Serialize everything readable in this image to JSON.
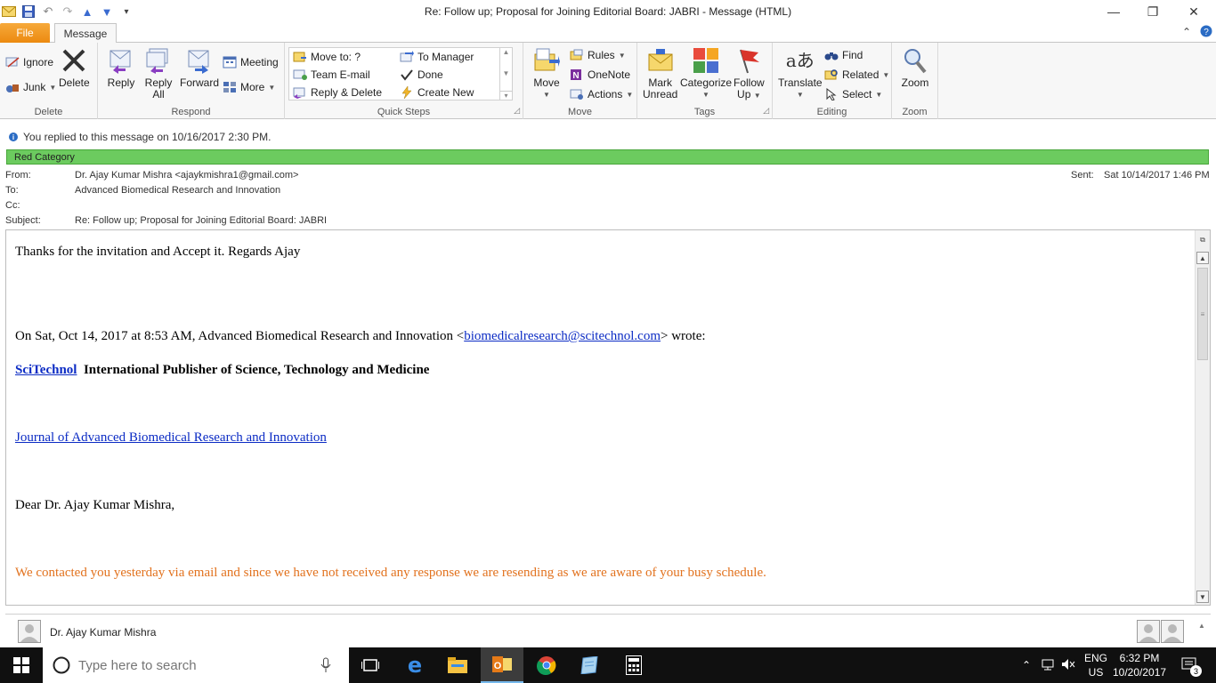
{
  "window": {
    "title": "Re: Follow up; Proposal for Joining Editorial Board: JABRI  -  Message (HTML)"
  },
  "tabs": {
    "file": "File",
    "message": "Message"
  },
  "ribbon": {
    "delete_group": {
      "label": "Delete",
      "ignore": "Ignore",
      "junk": "Junk",
      "delete": "Delete"
    },
    "respond_group": {
      "label": "Respond",
      "reply": "Reply",
      "reply_all_1": "Reply",
      "reply_all_2": "All",
      "forward": "Forward",
      "meeting": "Meeting",
      "more": "More"
    },
    "quicksteps_group": {
      "label": "Quick Steps",
      "move_to": "Move to: ?",
      "team_email": "Team E-mail",
      "reply_delete": "Reply & Delete",
      "to_manager": "To Manager",
      "done": "Done",
      "create_new": "Create New"
    },
    "move_group": {
      "label": "Move",
      "move": "Move",
      "rules": "Rules",
      "onenote": "OneNote",
      "actions": "Actions"
    },
    "tags_group": {
      "label": "Tags",
      "mark_unread_1": "Mark",
      "mark_unread_2": "Unread",
      "categorize": "Categorize",
      "follow_up_1": "Follow",
      "follow_up_2": "Up"
    },
    "editing_group": {
      "label": "Editing",
      "translate": "Translate",
      "find": "Find",
      "related": "Related",
      "select": "Select"
    },
    "zoom_group": {
      "label": "Zoom",
      "zoom": "Zoom"
    }
  },
  "info_bar": "You replied to this message on 10/16/2017 2:30 PM.",
  "category": "Red Category",
  "header": {
    "from_label": "From:",
    "from_value": "Dr. Ajay Kumar Mishra <ajaykmishra1@gmail.com>",
    "to_label": "To:",
    "to_value": "Advanced Biomedical Research and Innovation",
    "cc_label": "Cc:",
    "subject_label": "Subject:",
    "subject_value": "Re: Follow up; Proposal for Joining Editorial Board: JABRI",
    "sent_label": "Sent:",
    "sent_value": "Sat 10/14/2017 1:46 PM"
  },
  "body": {
    "line1": "Thanks for the invitation and Accept it. Regards Ajay",
    "quote_prefix": "On Sat, Oct 14, 2017 at 8:53 AM, Advanced Biomedical Research and Innovation <",
    "quote_email": "biomedicalresearch@scitechnol.com",
    "quote_suffix": "> wrote:",
    "brand_link": "SciTechnol",
    "brand_tagline": "International Publisher of Science, Technology and Medicine",
    "journal_link": "Journal of Advanced Biomedical Research and Innovation",
    "greeting": "Dear Dr. Ajay Kumar Mishra,",
    "orange_line": "We contacted you yesterday via email and since we have not received any response we are resending as we are aware of your busy schedule."
  },
  "people_pane": {
    "name": "Dr. Ajay Kumar Mishra"
  },
  "taskbar": {
    "search_placeholder": "Type here to search",
    "lang_1": "ENG",
    "lang_2": "US",
    "time": "6:32 PM",
    "date": "10/20/2017",
    "notifications": "3"
  },
  "colors": {
    "file_tab": "#ec8a10",
    "category_green": "#6ccb5f",
    "link_blue": "#0b2bc4",
    "orange_text": "#e2721e"
  }
}
